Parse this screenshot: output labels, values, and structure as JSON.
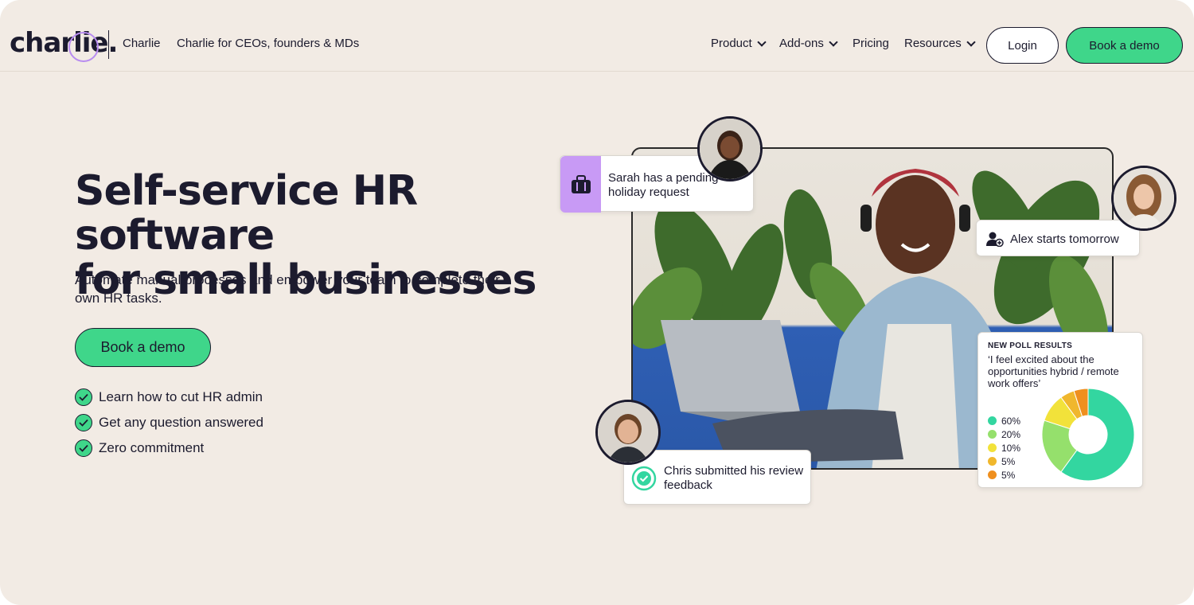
{
  "nav": {
    "logo": "charlie.",
    "links": [
      "Charlie",
      "Charlie for CEOs, founders & MDs"
    ],
    "menu": [
      {
        "label": "Product",
        "dropdown": true
      },
      {
        "label": "Add-ons",
        "dropdown": true
      },
      {
        "label": "Pricing",
        "dropdown": false
      },
      {
        "label": "Resources",
        "dropdown": true
      }
    ],
    "login_label": "Login",
    "demo_label": "Book a demo"
  },
  "hero": {
    "title_line1": "Self-service HR software",
    "title_line2": "for small businesses",
    "subtitle": "Automate manual processes and empower your team to complete their own HR tasks.",
    "cta_label": "Book a demo",
    "checks": [
      "Learn how to cut HR admin",
      "Get any question answered",
      "Zero commitment"
    ]
  },
  "cards": {
    "holiday": "Sarah has a pending holiday request",
    "starter": "Alex starts tomorrow",
    "review": "Chris submitted his review feedback"
  },
  "poll": {
    "heading": "NEW POLL RESULTS",
    "question": "‘I feel excited about the opportunities hybrid / remote work offers’",
    "legend": [
      "60%",
      "20%",
      "10%",
      "5%",
      "5%"
    ]
  },
  "colors": {
    "accent": "#3fd68a",
    "poll_teal": "#33d6a0",
    "poll_green": "#95e06c",
    "poll_yellow": "#f2e23a",
    "poll_amber": "#f0b72d",
    "poll_orange": "#ef8f1e",
    "holiday_icon_bg": "#c89af5"
  },
  "icons": [
    "chevron-down-icon",
    "check-circle-icon",
    "briefcase-icon",
    "add-user-icon",
    "check-badge-icon"
  ],
  "chart_data": {
    "type": "pie",
    "categories": [
      "60%",
      "20%",
      "10%",
      "5%",
      "5%"
    ],
    "values": [
      60,
      20,
      10,
      5,
      5
    ],
    "title": "NEW POLL RESULTS"
  }
}
